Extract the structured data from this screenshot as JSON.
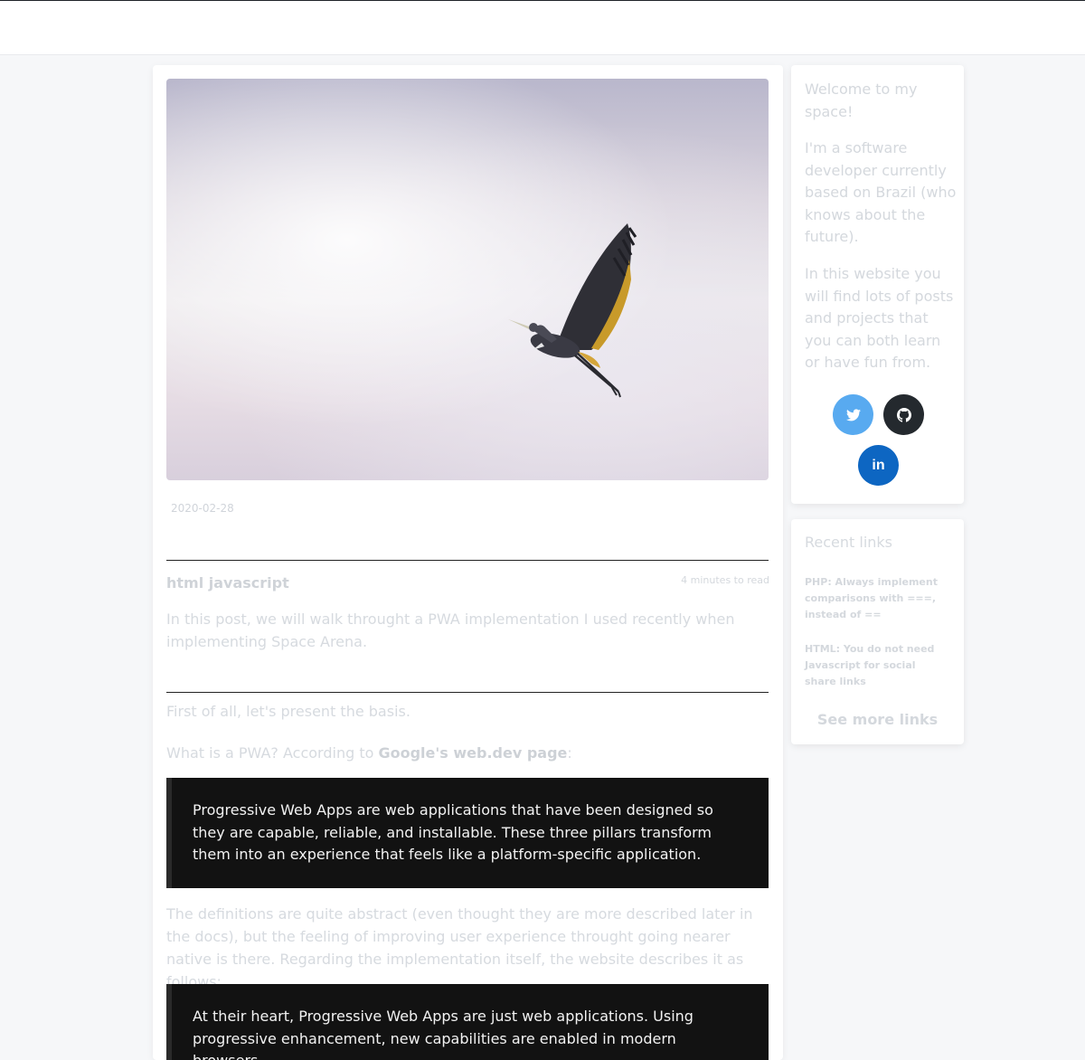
{
  "post": {
    "date": "2020-02-28",
    "tags": "html javascript",
    "read_time": "4 minutes to read",
    "summary": "In this post, we will walk throught a PWA implementation I used recently when implementing Space Arena.",
    "para1": "First of all, let's present the basis.",
    "para2_prefix": "What is a PWA? According to ",
    "para2_link": "Google's web.dev page",
    "para2_suffix": ":",
    "quote1": "Progressive Web Apps are web applications that have been designed so they are capable, reliable, and installable. These three pillars transform them into an experience that feels like a platform-specific application.",
    "para3": "The definitions are quite abstract (even thought they are more described later in the docs), but the feeling of improving user experience throught going nearer native is there. Regarding the implementation itself, the website describes it as follows:",
    "quote2": "At their heart, Progressive Web Apps are just web applications. Using progressive enhancement, new capabilities are enabled in modern browsers."
  },
  "sidebar": {
    "welcome_title": "Welcome to my space!",
    "welcome_p1": "I'm a software developer currently based on Brazil (who knows about the future).",
    "welcome_p2": "In this website you will find lots of posts and projects that you can both learn or have fun from.",
    "social": {
      "twitter": "twitter-icon",
      "github": "github-icon",
      "linkedin_label": "in"
    }
  },
  "recent": {
    "title": "Recent links",
    "links": [
      "PHP: Always implement comparisons with ===, instead of ==",
      "HTML: You do not need Javascript for social share links"
    ],
    "see_more": "See more links"
  },
  "colors": {
    "twitter": "#58aaf0",
    "github": "#24292e",
    "linkedin": "#0d66c2",
    "quote_bg": "#121212"
  }
}
